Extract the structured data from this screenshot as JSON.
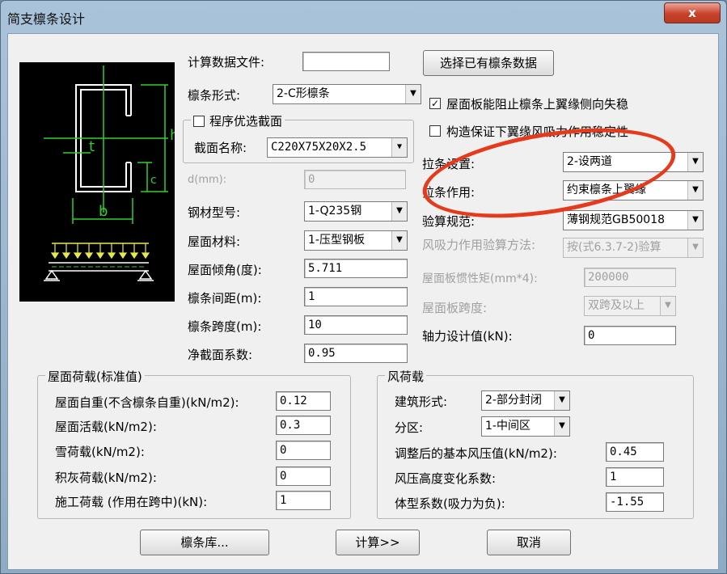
{
  "window": {
    "title": "简支檩条设计",
    "close_symbol": "x"
  },
  "drawing": {
    "label_h": "h",
    "label_t": "t",
    "label_c": "c",
    "label_b": "b"
  },
  "top": {
    "calc_file_label": "计算数据文件:",
    "calc_file_value": "",
    "select_existing_button": "选择已有檩条数据",
    "purlin_form_label": "檩条形式:",
    "purlin_form_value": "2-C形檩条",
    "auto_section_label": "程序优选截面",
    "section_name_label": "截面名称:",
    "section_name_value": "C220X75X20X2.5",
    "d_label": "d(mm):",
    "d_value": "0",
    "steel_label": "钢材型号:",
    "steel_value": "1-Q235钢",
    "roof_material_label": "屋面材料:",
    "roof_material_value": "1-压型钢板",
    "roof_angle_label": "屋面倾角(度):",
    "roof_angle_value": "5.711",
    "purlin_spacing_label": "檩条间距(m):",
    "purlin_spacing_value": "1",
    "purlin_span_label": "檩条跨度(m):",
    "purlin_span_value": "10",
    "net_section_label": "净截面系数:",
    "net_section_value": "0.95"
  },
  "right": {
    "roof_prevents_label": "屋面板能阻止檩条上翼缘侧向失稳",
    "roof_prevents_checked": "✓",
    "construct_guarantee_label": "构造保证下翼缘风吸力作用稳定性",
    "brace_setting_label": "拉条设置:",
    "brace_setting_value": "2-设两道",
    "brace_action_label": "拉条作用:",
    "brace_action_value": "约束檩条上翼缘",
    "code_label": "验算规范:",
    "code_value": "薄钢规范GB50018",
    "wind_method_label": "风吸力作用验算方法:",
    "wind_method_value": "按(式6.3.7-2)验算",
    "roof_inertia_label": "屋面板惯性矩(mm*4):",
    "roof_inertia_value": "200000",
    "roof_span_label": "屋面板跨度:",
    "roof_span_value": "双跨及以上",
    "axial_force_label": "轴力设计值(kN):",
    "axial_force_value": "0"
  },
  "roof_load": {
    "title": "屋面荷载(标准值)",
    "self_weight_label": "屋面自重(不含檩条自重)(kN/m2):",
    "self_weight_value": "0.12",
    "live_load_label": "屋面活载(kN/m2):",
    "live_load_value": "0.3",
    "snow_label": "雪荷载(kN/m2):",
    "snow_value": "0",
    "ash_label": "积灰荷载(kN/m2):",
    "ash_value": "0",
    "construction_label": "施工荷载 (作用在跨中)(kN):",
    "construction_value": "1"
  },
  "wind_load": {
    "title": "风荷载",
    "building_form_label": "建筑形式:",
    "building_form_value": "2-部分封闭",
    "zone_label": "分区:",
    "zone_value": "1-中间区",
    "basic_pressure_label": "调整后的基本风压值(kN/m2):",
    "basic_pressure_value": "0.45",
    "height_coef_label": "风压高度变化系数:",
    "height_coef_value": "1",
    "shape_coef_label": "体型系数(吸力为负):",
    "shape_coef_value": "-1.55"
  },
  "footer": {
    "library_button": "檩条库...",
    "calc_button": "计算>>",
    "cancel_button": "取消"
  }
}
